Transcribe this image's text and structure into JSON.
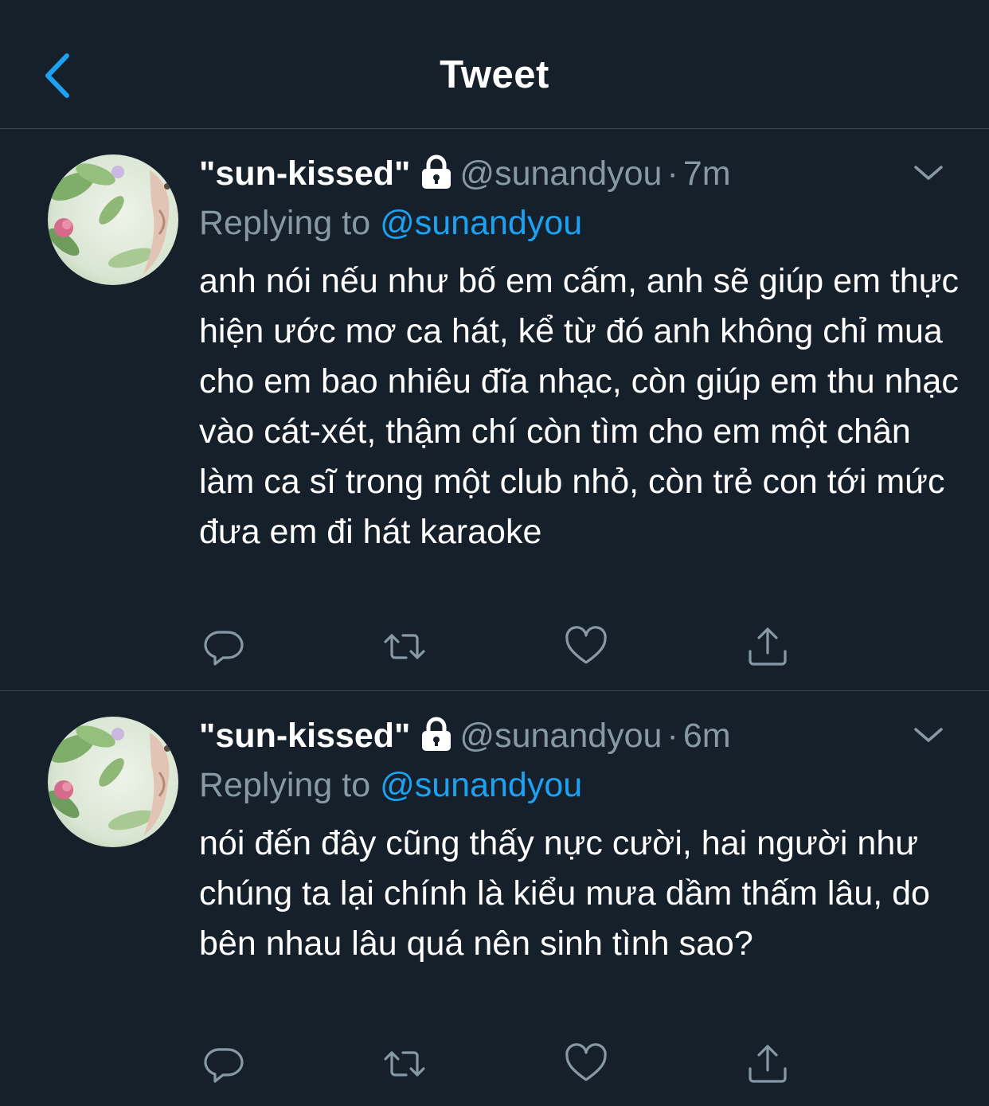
{
  "header": {
    "title": "Tweet",
    "back_icon": "chevron-left-icon",
    "accent_color": "#1da1f2"
  },
  "colors": {
    "background": "#15202b",
    "secondary_text": "#8899a6",
    "divider": "#38444d",
    "link": "#1da1f2"
  },
  "tweets": [
    {
      "display_name": "\"sun-kissed\"",
      "protected_icon": "lock-icon",
      "handle": "@sunandyou",
      "separator": "·",
      "time": "7m",
      "replying_prefix": "Replying to",
      "replying_to": "@sunandyou",
      "text": "anh nói nếu như bố em cấm, anh sẽ giúp em thực hiện ước mơ ca hát, kể từ đó anh không chỉ mua cho em bao nhiêu đĩa nhạc, còn giúp em thu nhạc vào cát-xét, thậm chí còn tìm cho em một chân làm ca sĩ trong một club nhỏ, còn trẻ con tới mức đưa em đi hát karaoke",
      "actions": [
        "reply-icon",
        "retweet-icon",
        "like-icon",
        "share-icon"
      ]
    },
    {
      "display_name": "\"sun-kissed\"",
      "protected_icon": "lock-icon",
      "handle": "@sunandyou",
      "separator": "·",
      "time": "6m",
      "replying_prefix": "Replying to",
      "replying_to": "@sunandyou",
      "text": "nói đến đây cũng thấy nực cười, hai người như chúng ta lại chính là kiểu mưa dầm thấm lâu, do bên nhau lâu quá nên sinh tình sao?",
      "actions": [
        "reply-icon",
        "retweet-icon",
        "like-icon",
        "share-icon"
      ]
    }
  ]
}
